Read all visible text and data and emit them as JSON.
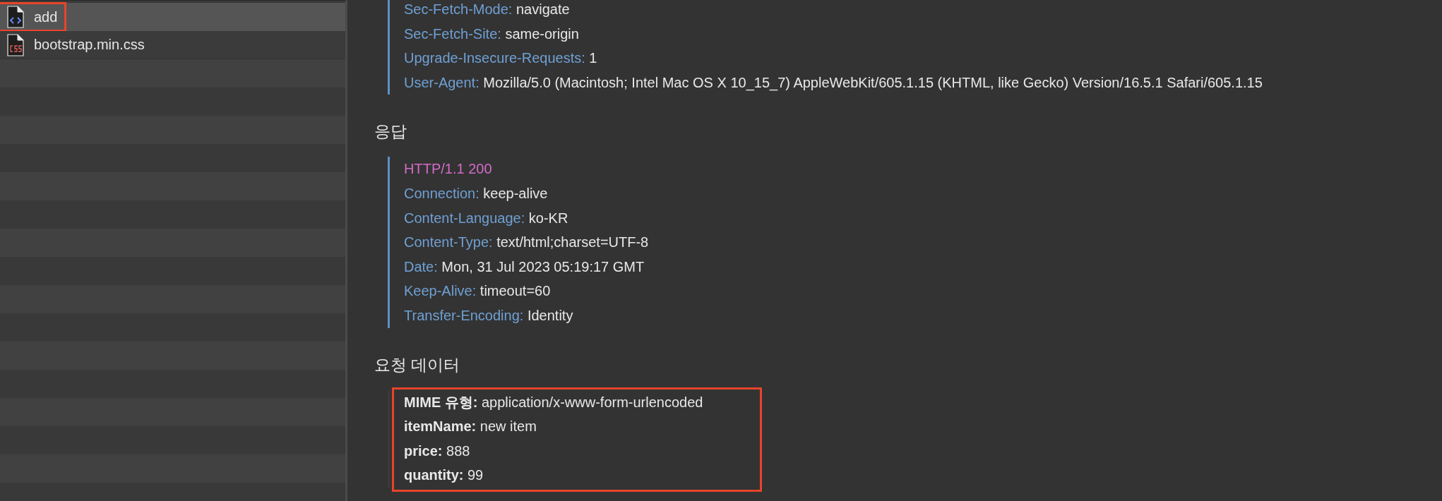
{
  "sidebar": {
    "items": [
      {
        "name": "add",
        "kind": "document",
        "selected": true,
        "highlighted": true
      },
      {
        "name": "bootstrap.min.css",
        "kind": "stylesheet",
        "selected": false,
        "highlighted": false
      }
    ]
  },
  "sections": [
    {
      "kind": "headers",
      "highlighted": false,
      "lines": [
        {
          "kind": "field",
          "key": "Sec-Fetch-Mode:",
          "value": "navigate"
        },
        {
          "kind": "field",
          "key": "Sec-Fetch-Site:",
          "value": "same-origin"
        },
        {
          "kind": "field",
          "key": "Upgrade-Insecure-Requests:",
          "value": "1"
        },
        {
          "kind": "field",
          "key": "User-Agent:",
          "value": "Mozilla/5.0 (Macintosh; Intel Mac OS X 10_15_7) AppleWebKit/605.1.15 (KHTML, like Gecko) Version/16.5.1 Safari/605.1.15"
        }
      ]
    },
    {
      "kind": "headers",
      "title": "응답",
      "highlighted": false,
      "lines": [
        {
          "kind": "status",
          "text": "HTTP/1.1 200"
        },
        {
          "kind": "field",
          "key": "Connection:",
          "value": "keep-alive"
        },
        {
          "kind": "field",
          "key": "Content-Language:",
          "value": "ko-KR"
        },
        {
          "kind": "field",
          "key": "Content-Type:",
          "value": "text/html;charset=UTF-8"
        },
        {
          "kind": "field",
          "key": "Date:",
          "value": "Mon, 31 Jul 2023 05:19:17 GMT"
        },
        {
          "kind": "field",
          "key": "Keep-Alive:",
          "value": "timeout=60"
        },
        {
          "kind": "field",
          "key": "Transfer-Encoding:",
          "value": "Identity"
        }
      ]
    },
    {
      "kind": "params",
      "title": "요청 데이터",
      "highlighted": true,
      "lines": [
        {
          "kind": "field",
          "key": "MIME 유형:",
          "value": "application/x-www-form-urlencoded"
        },
        {
          "kind": "field",
          "key": "itemName:",
          "value": "new item"
        },
        {
          "kind": "field",
          "key": "price:",
          "value": "888"
        },
        {
          "kind": "field",
          "key": "quantity:",
          "value": "99"
        }
      ]
    }
  ]
}
